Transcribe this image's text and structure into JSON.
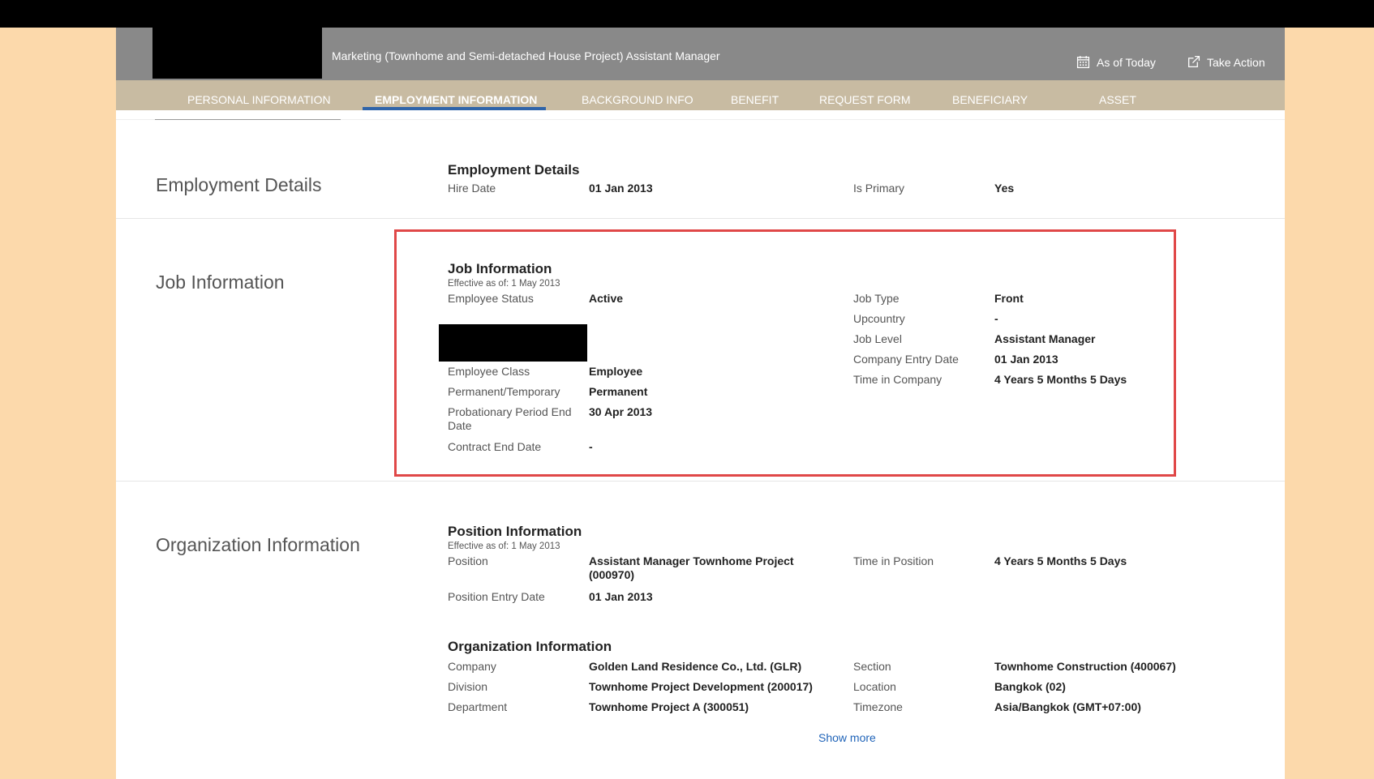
{
  "header": {
    "employee_title": "Marketing (Townhome and Semi-detached House Project) Assistant Manager",
    "as_of_label": "As of Today",
    "take_action_label": "Take Action"
  },
  "tabs": [
    {
      "label": "PERSONAL INFORMATION",
      "active": false
    },
    {
      "label": "EMPLOYMENT INFORMATION",
      "active": true
    },
    {
      "label": "BACKGROUND INFO",
      "active": false
    },
    {
      "label": "BENEFIT",
      "active": false
    },
    {
      "label": "REQUEST FORM",
      "active": false
    },
    {
      "label": "BENEFICIARY",
      "active": false
    },
    {
      "label": "ASSET",
      "active": false
    }
  ],
  "employment": {
    "section_title": "Employment Details",
    "block_title": "Employment Details",
    "hire_date_label": "Hire Date",
    "hire_date": "01 Jan 2013",
    "is_primary_label": "Is Primary",
    "is_primary": "Yes"
  },
  "job": {
    "section_title": "Job Information",
    "block_title": "Job Information",
    "effective": "Effective as of: 1 May 2013",
    "left": [
      {
        "label": "Employee Status",
        "value": "Active"
      },
      {
        "label": "Employee Class",
        "value": "Employee"
      },
      {
        "label": "Permanent/Temporary",
        "value": "Permanent"
      },
      {
        "label": "Probationary Period End Date",
        "value": "30 Apr 2013"
      },
      {
        "label": "Contract End Date",
        "value": "-"
      }
    ],
    "right": [
      {
        "label": "Job Type",
        "value": "Front"
      },
      {
        "label": "Upcountry",
        "value": "-"
      },
      {
        "label": "Job Level",
        "value": "Assistant Manager"
      },
      {
        "label": "Company Entry Date",
        "value": "01 Jan 2013"
      },
      {
        "label": "Time in Company",
        "value": "4 Years 5 Months 5 Days"
      }
    ]
  },
  "organization": {
    "section_title": "Organization Information",
    "position_block_title": "Position Information",
    "position_effective": "Effective as of: 1 May 2013",
    "position_label": "Position",
    "position_value": "Assistant Manager Townhome Project (000970)",
    "position_entry_label": "Position Entry Date",
    "position_entry_value": "01 Jan 2013",
    "time_in_position_label": "Time in Position",
    "time_in_position_value": "4 Years 5 Months 5 Days",
    "org_block_title": "Organization Information",
    "left": [
      {
        "label": "Company",
        "value": "Golden Land Residence Co., Ltd. (GLR)"
      },
      {
        "label": "Division",
        "value": "Townhome Project Development (200017)"
      },
      {
        "label": "Department",
        "value": "Townhome Project A (300051)"
      }
    ],
    "right": [
      {
        "label": "Section",
        "value": "Townhome Construction (400067)"
      },
      {
        "label": "Location",
        "value": "Bangkok (02)"
      },
      {
        "label": "Timezone",
        "value": "Asia/Bangkok (GMT+07:00)"
      }
    ],
    "show_more_label": "Show more"
  },
  "colors": {
    "header_bg": "#898989",
    "tabbar_bg": "#c8bba2",
    "active_tab_underline": "#2f64a9",
    "highlight_border": "#e04848",
    "link": "#1f63b8",
    "page_bg": "#fcd9ab"
  }
}
